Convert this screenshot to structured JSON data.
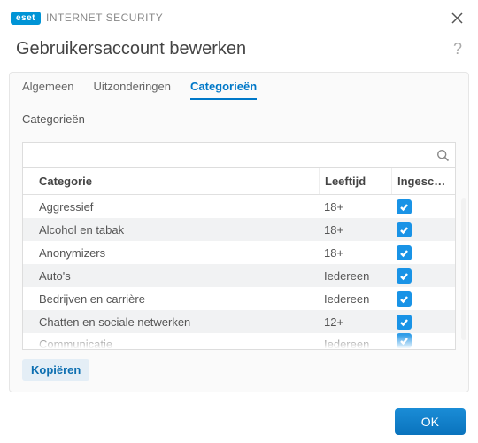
{
  "app": {
    "brand": "eset",
    "product": "INTERNET SECURITY"
  },
  "window": {
    "title": "Gebruikersaccount bewerken"
  },
  "tabs": [
    {
      "id": "algemeen",
      "label": "Algemeen",
      "active": false
    },
    {
      "id": "uitzonderingen",
      "label": "Uitzonderingen",
      "active": false
    },
    {
      "id": "categorieen",
      "label": "Categorieën",
      "active": true
    }
  ],
  "section": {
    "label": "Categorieën"
  },
  "search": {
    "placeholder": ""
  },
  "table": {
    "headers": {
      "category": "Categorie",
      "age": "Leeftijd",
      "enabled": "Ingescha..."
    },
    "rows": [
      {
        "category": "Aggressief",
        "age": "18+",
        "enabled": true
      },
      {
        "category": "Alcohol en tabak",
        "age": "18+",
        "enabled": true
      },
      {
        "category": "Anonymizers",
        "age": "18+",
        "enabled": true
      },
      {
        "category": "Auto's",
        "age": "Iedereen",
        "enabled": true
      },
      {
        "category": "Bedrijven en carrière",
        "age": "Iedereen",
        "enabled": true
      },
      {
        "category": "Chatten en sociale netwerken",
        "age": "12+",
        "enabled": true
      },
      {
        "category": "Communicatie",
        "age": "Iedereen",
        "enabled": true
      }
    ]
  },
  "buttons": {
    "copy": "Kopiëren",
    "ok": "OK"
  }
}
